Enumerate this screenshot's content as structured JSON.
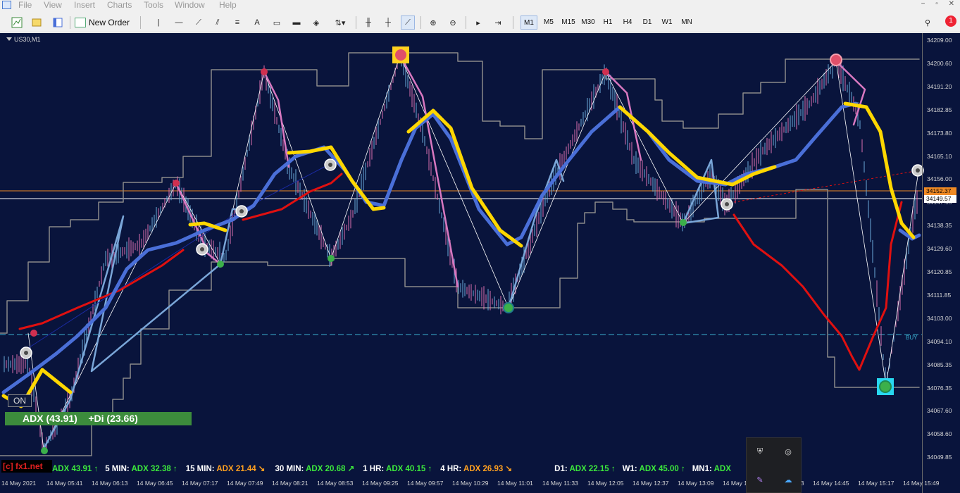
{
  "menu": {
    "items": [
      "File",
      "View",
      "Insert",
      "Charts",
      "Tools",
      "Window",
      "Help"
    ]
  },
  "window_controls": [
    "−",
    "▫",
    "✕"
  ],
  "toolbar": {
    "new_order_label": "New Order",
    "timeframes": [
      "M1",
      "M5",
      "M15",
      "M30",
      "H1",
      "H4",
      "D1",
      "W1",
      "MN"
    ],
    "active_timeframe": "M1",
    "notification_count": "1"
  },
  "chart": {
    "title": "US30,M1",
    "price_axis": [
      "34209.00",
      "34200.60",
      "34191.20",
      "34182.85",
      "34173.80",
      "34165.10",
      "34156.00",
      "34147.65",
      "34138.35",
      "34129.60",
      "34120.85",
      "34111.85",
      "34103.00",
      "34094.10",
      "34085.35",
      "34076.35",
      "34067.60",
      "34058.60",
      "34049.85"
    ],
    "price_orange": "34152.37",
    "price_white": "34149.57",
    "time_axis": [
      "14 May 2021",
      "14 May 05:41",
      "14 May 06:13",
      "14 May 06:45",
      "14 May 07:17",
      "14 May 07:49",
      "14 May 08:21",
      "14 May 08:53",
      "14 May 09:25",
      "14 May 09:57",
      "14 May 10:29",
      "14 May 11:01",
      "14 May 11:33",
      "14 May 12:05",
      "14 May 12:37",
      "14 May 13:09",
      "14 May 13:41",
      "14 May 14:13",
      "14 May 14:45",
      "14 May 15:17",
      "14 May 15:49"
    ],
    "buy_label": "BUY",
    "on_button": "ON",
    "adx_box": "ADX (43.91)    +Di (23.66)",
    "watermark": "[c] fx1.net",
    "colors": {
      "background": "#09143c",
      "yellow_ma": "#ffd700",
      "blue_ma": "#4a6fd8",
      "red_line": "#e01010",
      "channel": "#8a8a8a",
      "adx_green": "#3c8c3c"
    }
  },
  "adx_bar": [
    {
      "tf": "",
      "value": "ADX 43.91",
      "arrow": "↑",
      "color": "#3ce83c"
    },
    {
      "tf": "5 MIN:",
      "value": "ADX 32.38",
      "arrow": "↑",
      "color": "#3ce83c"
    },
    {
      "tf": "15 MIN:",
      "value": "ADX 21.44",
      "arrow": "↘",
      "color": "#ffa020"
    },
    {
      "tf": "30 MIN:",
      "value": "ADX 20.68",
      "arrow": "↗",
      "color": "#3ce83c"
    },
    {
      "tf": "1 HR:",
      "value": "ADX 40.15",
      "arrow": "↑",
      "color": "#3ce83c"
    },
    {
      "tf": "4 HR:",
      "value": "ADX 26.93",
      "arrow": "↘",
      "color": "#ffa020"
    },
    {
      "tf": "D1:",
      "value": "ADX 22.15",
      "arrow": "↑",
      "color": "#3ce83c"
    },
    {
      "tf": "W1:",
      "value": "ADX 45.00",
      "arrow": "↑",
      "color": "#3ce83c"
    },
    {
      "tf": "MN1:",
      "value": "ADX",
      "arrow": "",
      "color": "#3ce83c"
    }
  ]
}
